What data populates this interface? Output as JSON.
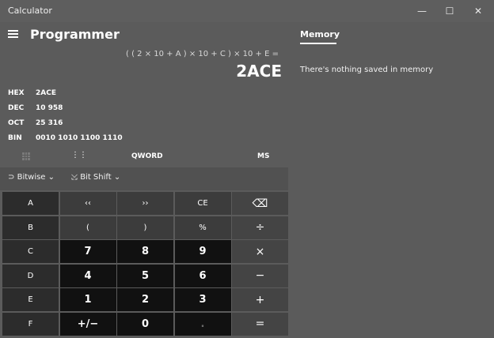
{
  "window": {
    "title": "Calculator",
    "minimize": "—",
    "maximize": "☐",
    "close": "✕"
  },
  "header": {
    "mode": "Programmer"
  },
  "display": {
    "expression": "( ( 2 × 10 + A ) × 10 + C ) × 10 + E =",
    "result": "2ACE"
  },
  "radix": [
    {
      "label": "HEX",
      "value": "2ACE"
    },
    {
      "label": "DEC",
      "value": "10 958"
    },
    {
      "label": "OCT",
      "value": "25 316"
    },
    {
      "label": "BIN",
      "value": "0010 1010 1100 1110"
    }
  ],
  "word_size": "QWORD",
  "memory_store": "MS",
  "bitwise": {
    "label": "Bitwise",
    "icon": "bitwise-icon"
  },
  "bitshift": {
    "label": "Bit Shift",
    "icon": "bitshift-icon"
  },
  "keys": [
    [
      "A",
      "‹‹",
      "››",
      "CE",
      "⌫"
    ],
    [
      "B",
      "(",
      ")",
      "%",
      "÷"
    ],
    [
      "C",
      "7",
      "8",
      "9",
      "×"
    ],
    [
      "D",
      "4",
      "5",
      "6",
      "−"
    ],
    [
      "E",
      "1",
      "2",
      "3",
      "+"
    ],
    [
      "F",
      "+/−",
      "0",
      ".",
      "="
    ]
  ],
  "memory_panel": {
    "title": "Memory",
    "empty_text": "There's nothing saved in memory"
  }
}
